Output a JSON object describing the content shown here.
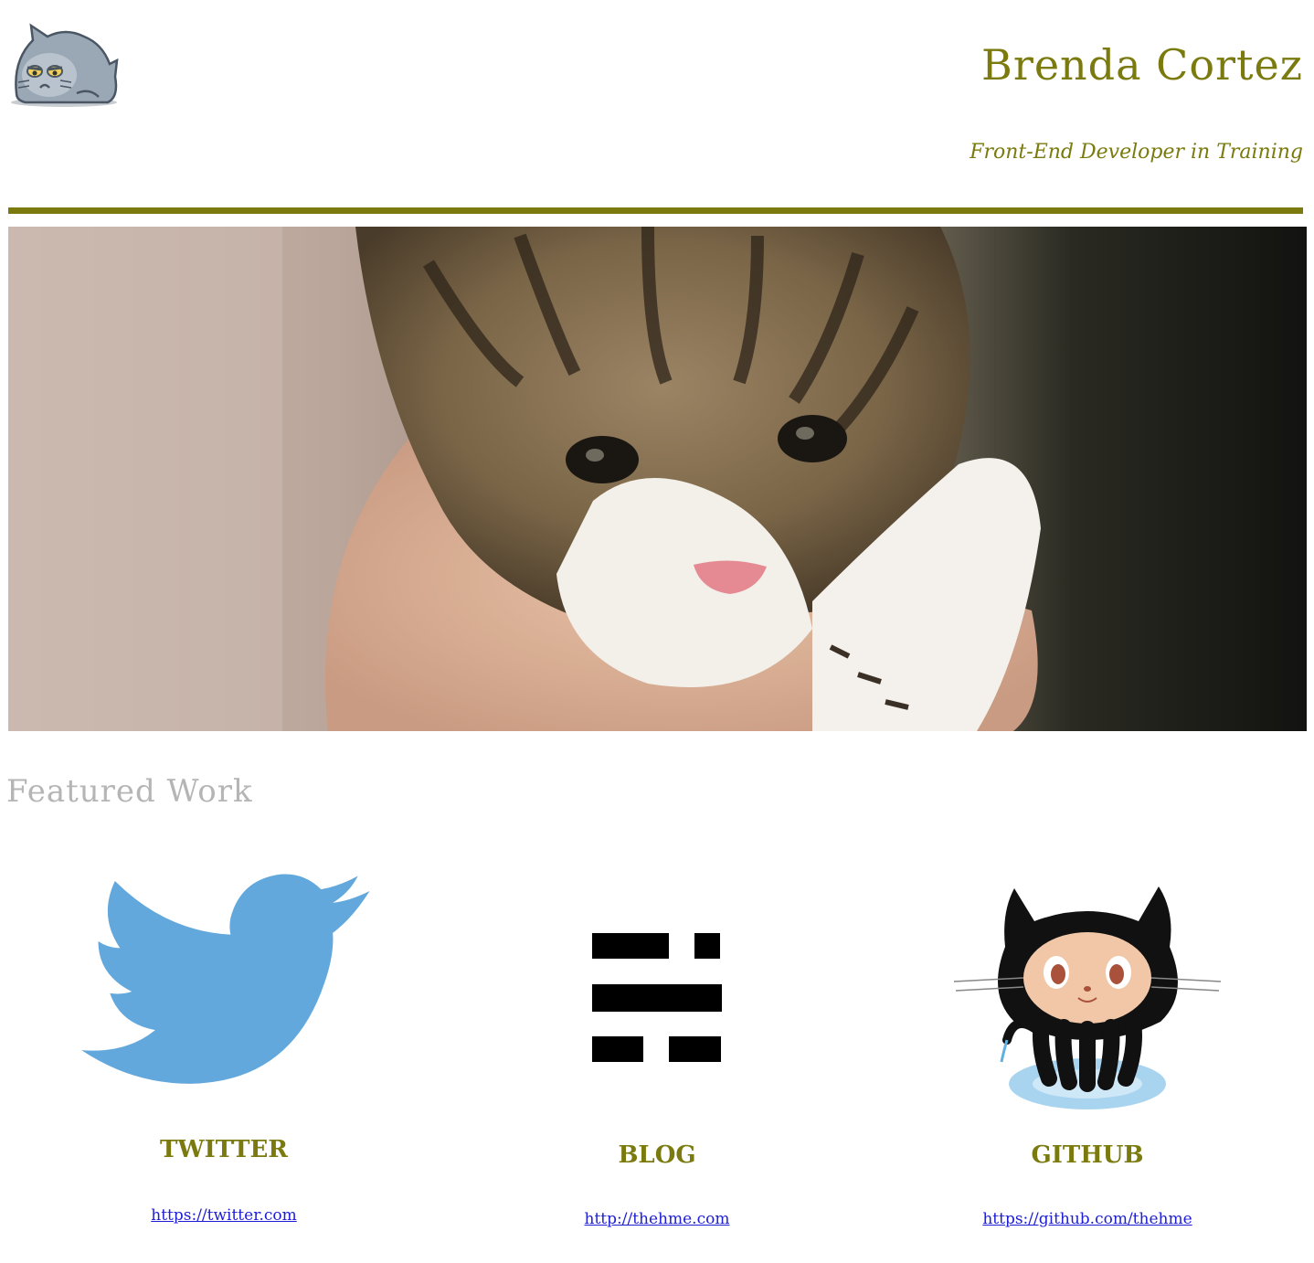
{
  "header": {
    "name": "Brenda Cortez",
    "subtitle": "Front-End Developer in Training",
    "logo_icon": "grumpy-cat-icon",
    "accent_color": "#7a7a0e"
  },
  "hero": {
    "image_icon": "kitten-photo"
  },
  "featured": {
    "title": "Featured Work",
    "items": [
      {
        "title": "TWITTER",
        "link": "https://twitter.com",
        "icon": "twitter-bird-icon",
        "color": "#62a8dc"
      },
      {
        "title": "BLOG",
        "link": "http://thehme.com",
        "icon": "blog-logo-icon",
        "color": "#000000"
      },
      {
        "title": "GITHUB",
        "link": "https://github.com/thehme",
        "icon": "octocat-icon",
        "color": "#000000"
      }
    ]
  }
}
